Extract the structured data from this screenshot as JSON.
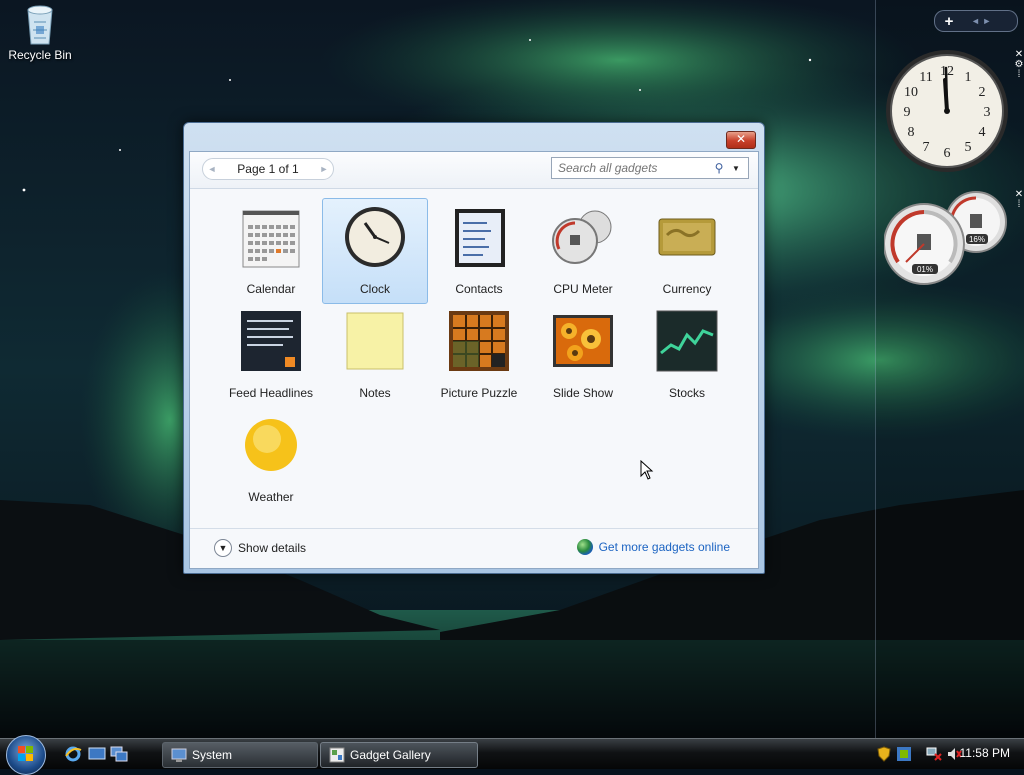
{
  "desktop": {
    "icons": [
      {
        "label": "Recycle Bin",
        "icon": "recycle-bin-icon"
      }
    ]
  },
  "sidebar": {
    "add_label": "+",
    "nav_label": "◄ ►"
  },
  "gallery": {
    "pager_text": "Page 1 of 1",
    "search_placeholder": "Search all gadgets",
    "close_label": "✕",
    "gadgets": [
      {
        "name": "Calendar",
        "icon": "calendar-icon",
        "selected": false
      },
      {
        "name": "Clock",
        "icon": "clock-icon",
        "selected": true
      },
      {
        "name": "Contacts",
        "icon": "contacts-icon",
        "selected": false
      },
      {
        "name": "CPU Meter",
        "icon": "cpu-meter-icon",
        "selected": false
      },
      {
        "name": "Currency",
        "icon": "currency-icon",
        "selected": false
      },
      {
        "name": "Feed Headlines",
        "icon": "feed-headlines-icon",
        "selected": false
      },
      {
        "name": "Notes",
        "icon": "notes-icon",
        "selected": false
      },
      {
        "name": "Picture Puzzle",
        "icon": "picture-puzzle-icon",
        "selected": false
      },
      {
        "name": "Slide Show",
        "icon": "slide-show-icon",
        "selected": false
      },
      {
        "name": "Stocks",
        "icon": "stocks-icon",
        "selected": false
      },
      {
        "name": "Weather",
        "icon": "weather-icon",
        "selected": false
      }
    ],
    "show_details": "Show details",
    "more_online": "Get more gadgets online"
  },
  "taskbar": {
    "buttons": [
      {
        "label": "System",
        "icon": "system-icon"
      },
      {
        "label": "Gadget Gallery",
        "icon": "gadget-gallery-icon"
      }
    ],
    "clock": "11:58 PM"
  },
  "colors": {
    "accent": "#1c64c2",
    "selection": "#c5dff8",
    "close_button": "#c8402a"
  }
}
